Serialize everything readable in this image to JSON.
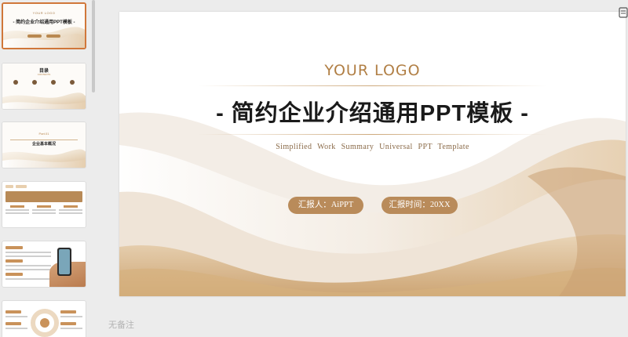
{
  "slide": {
    "logo": "YOUR LOGO",
    "title": "- 简约企业介绍通用PPT模板 -",
    "subtitle": "Simplified Work Summary Universal PPT Template",
    "reporter": "汇报人：AiPPT",
    "report_time": "汇报时间：20XX"
  },
  "notes_placeholder": "无备注",
  "thumbnails": [
    {
      "logo": "YOUR LOGO",
      "title": "- 简约企业介绍通用PPT模板 -",
      "active": true
    },
    {
      "title": "目录",
      "subtitle": "CONTENTS"
    },
    {
      "part": "Part.01",
      "title": "企业基本概况"
    },
    {},
    {},
    {}
  ],
  "colors": {
    "accent": "#b98b5a",
    "active_border": "#d0773a",
    "logo": "#b17f45"
  },
  "icons": [
    "panel-toggle-icon"
  ]
}
